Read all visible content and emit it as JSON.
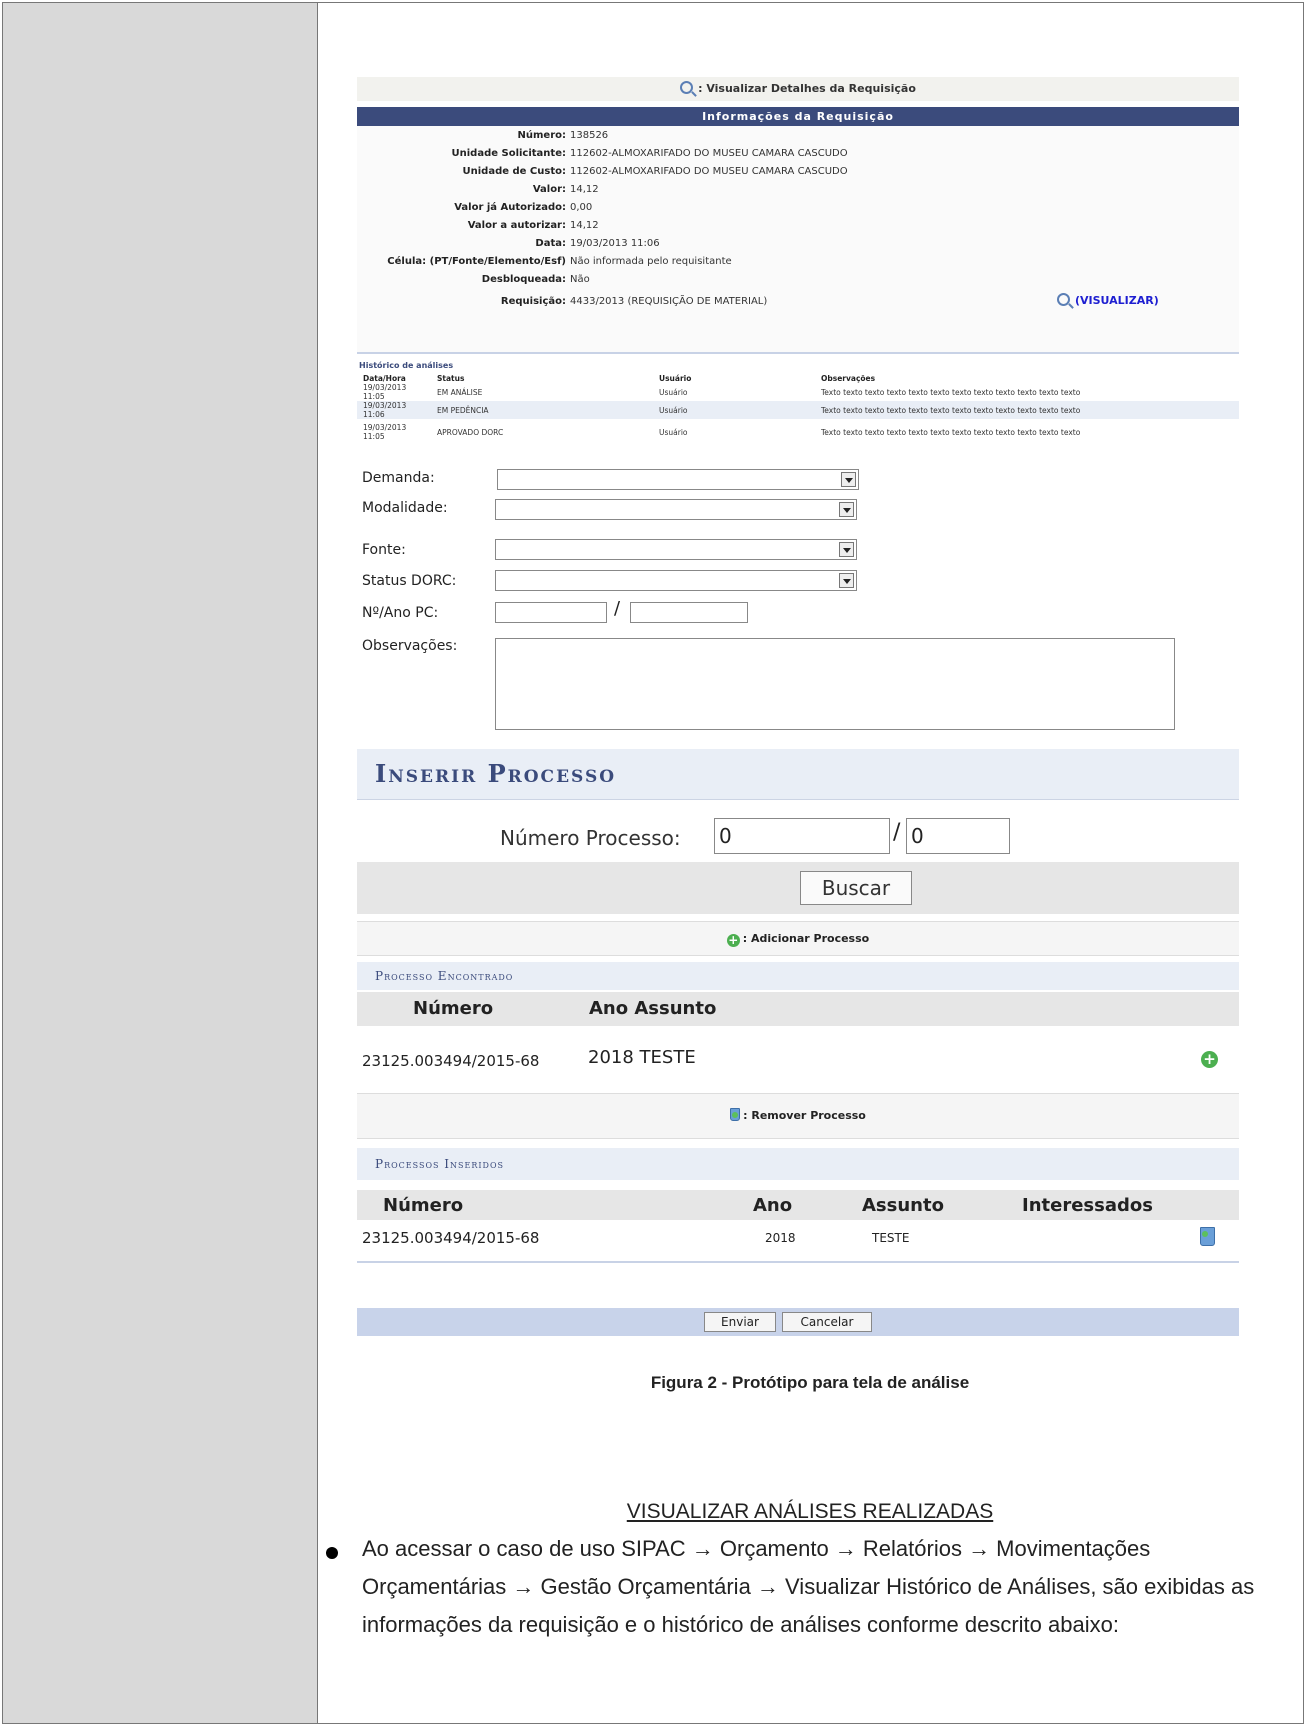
{
  "legend": {
    "text": ": Visualizar Detalhes da Requisição"
  },
  "info": {
    "header": "Informações da Requisição",
    "rows": [
      {
        "label": "Número:",
        "value": "138526"
      },
      {
        "label": "Unidade Solicitante:",
        "value": "112602-ALMOXARIFADO DO MUSEU CAMARA CASCUDO"
      },
      {
        "label": "Unidade de Custo:",
        "value": "112602-ALMOXARIFADO DO MUSEU CAMARA CASCUDO"
      },
      {
        "label": "Valor:",
        "value": "14,12"
      },
      {
        "label": "Valor já Autorizado:",
        "value": "0,00"
      },
      {
        "label": "Valor a autorizar:",
        "value": "14,12"
      },
      {
        "label": "Data:",
        "value": "19/03/2013 11:06"
      },
      {
        "label": "Célula: (PT/Fonte/Elemento/Esf)",
        "value": "Não informada pelo requisitante"
      },
      {
        "label": "Desbloqueada:",
        "value": "Não"
      },
      {
        "label": "Requisição:",
        "value": "4433/2013 (REQUISIÇÃO DE MATERIAL)"
      }
    ],
    "visualizar_link": "(VISUALIZAR)"
  },
  "historico": {
    "title": "Histórico de análises",
    "headers": [
      "Data/Hora",
      "Status",
      "Usuário",
      "Observações"
    ],
    "rows": [
      [
        "19/03/2013 11:05",
        "EM ANÁLISE",
        "Usuário",
        "Texto texto texto texto texto texto texto texto texto texto texto texto"
      ],
      [
        "19/03/2013 11:06",
        "EM PEDÊNCIA",
        "Usuário",
        "Texto texto texto texto texto texto texto texto texto texto texto texto"
      ],
      [
        "19/03/2013 11:05",
        "APROVADO DORC",
        "Usuário",
        "Texto texto texto texto texto texto texto texto texto texto texto texto"
      ]
    ]
  },
  "form": {
    "demanda": "Demanda:",
    "modalidade": "Modalidade:",
    "fonte": "Fonte:",
    "status_dorc": "Status DORC:",
    "numero_ano_pc": "Nº/Ano PC:",
    "slash": "/",
    "observacoes": "Observações:"
  },
  "inserir": {
    "title": "Inserir Processo",
    "numero_label": "Número Processo:",
    "numero_value": "0",
    "ano_value": "0",
    "slash": "/",
    "buscar": "Buscar"
  },
  "adicionar_legend": ": Adicionar Processo",
  "encontrado": {
    "title": "Processo Encontrado",
    "headers": {
      "numero": "Número",
      "ano_assunto": "Ano Assunto"
    },
    "row": {
      "numero": "23125.003494/2015-68",
      "ano_assunto": "2018 TESTE"
    }
  },
  "remover_legend": ": Remover Processo",
  "inseridos": {
    "title": "Processos Inseridos",
    "headers": {
      "numero": "Número",
      "ano": "Ano",
      "assunto": "Assunto",
      "interessados": "Interessados"
    },
    "row": {
      "numero": "23125.003494/2015-68",
      "ano": "2018",
      "assunto": "TESTE"
    }
  },
  "actions": {
    "enviar": "Enviar",
    "cancelar": "Cancelar"
  },
  "caption": "Figura 2 - Protótipo para tela de análise",
  "section_heading": "VISUALIZAR ANÁLISES REALIZADAS",
  "paragraph": "Ao acessar o caso de uso SIPAC → Orçamento → Relatórios → Movimentações Orçamentárias → Gestão Orçamentária → Visualizar Histórico de Análises, são exibidas as informações da requisição e o histórico de análises conforme descrito abaixo:"
}
